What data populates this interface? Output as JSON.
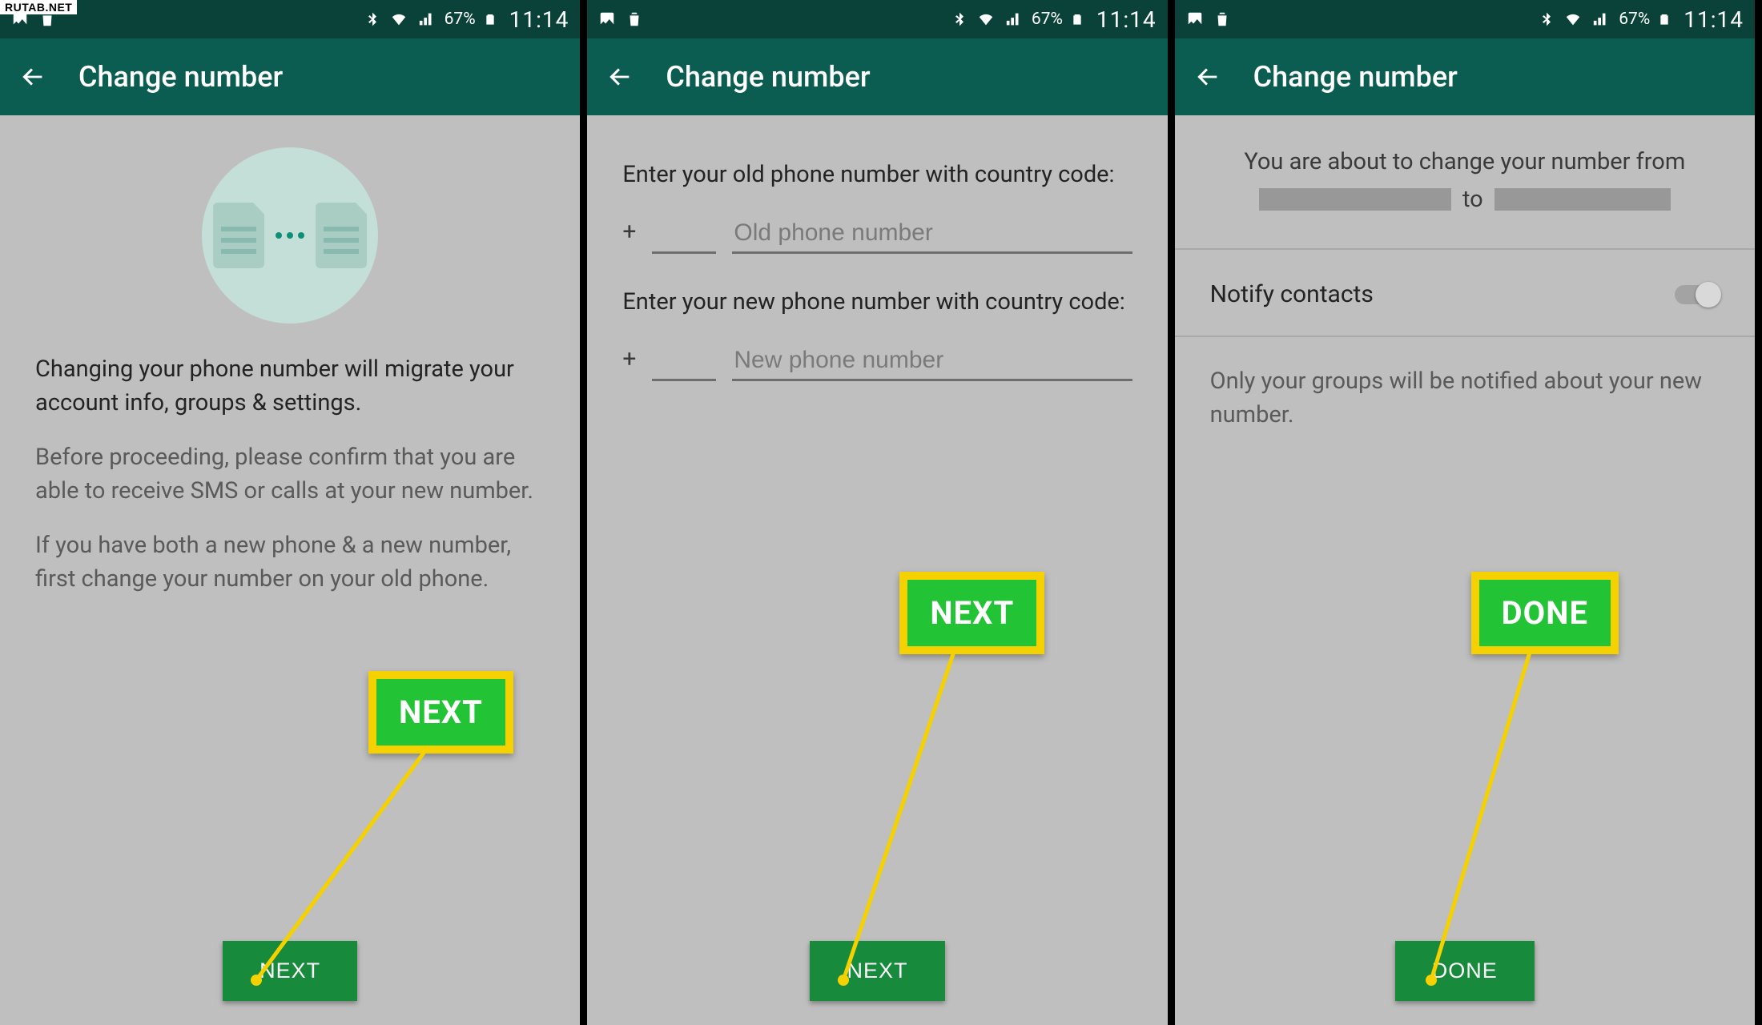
{
  "watermark": "RUTAB.NET",
  "status": {
    "battery_pct": "67%",
    "time": "11:14"
  },
  "header": {
    "title": "Change number"
  },
  "screen1": {
    "para_main": "Changing your phone number will migrate your account info, groups & settings.",
    "para_sms": "Before proceeding, please confirm that you are able to receive SMS or calls at your new number.",
    "para_both": "If you have both a new phone & a new number, first change your number on your old phone.",
    "button": "NEXT",
    "callout": "NEXT"
  },
  "screen2": {
    "old_label": "Enter your old phone number with country code:",
    "new_label": "Enter your new phone number with country code:",
    "plus": "+",
    "old_placeholder": "Old phone number",
    "new_placeholder": "New phone number",
    "button": "NEXT",
    "callout": "NEXT"
  },
  "screen3": {
    "confirm_line": "You are about to change your number from",
    "to_word": "to",
    "notify_label": "Notify contacts",
    "note": "Only your groups will be notified about your new number.",
    "button": "DONE",
    "callout": "DONE"
  }
}
